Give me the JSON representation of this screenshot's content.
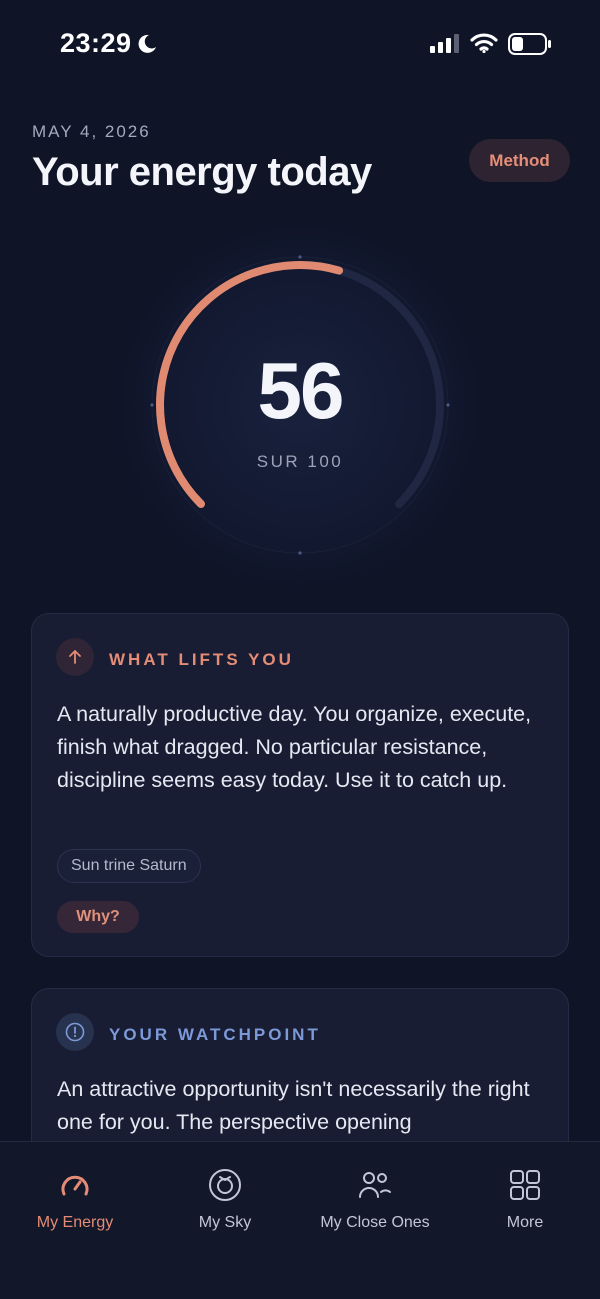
{
  "status_bar": {
    "time": "23:29",
    "icons": [
      "moon-icon",
      "signal-icon",
      "wifi-icon",
      "battery-icon"
    ]
  },
  "header": {
    "date": "MAY 4, 2026",
    "title": "Your energy today",
    "method_label": "Method"
  },
  "gauge": {
    "score": "56",
    "scale_label": "SUR 100",
    "score_value": 56,
    "score_max": 100,
    "arc_color": "#e08a72",
    "track_color": "#1f2742"
  },
  "cards": {
    "lifts": {
      "icon": "arrow-up-icon",
      "heading": "WHAT LIFTS YOU",
      "text": "A naturally productive day. You organize, execute, finish what dragged. No particular resistance, discipline seems easy today. Use it to catch up.",
      "aspect": "Sun trine Saturn",
      "why_label": "Why?",
      "accent": "#e58c76"
    },
    "watchpoint": {
      "icon": "alert-circle-icon",
      "heading": "YOUR WATCHPOINT",
      "text": "An attractive opportunity isn't necessarily the right one for you. The perspective opening",
      "accent": "#7c99d8"
    }
  },
  "tabs": [
    {
      "label": "My Energy",
      "icon": "gauge-icon",
      "active": true
    },
    {
      "label": "My Sky",
      "icon": "sky-icon",
      "active": false
    },
    {
      "label": "My Close Ones",
      "icon": "people-icon",
      "active": false
    },
    {
      "label": "More",
      "icon": "grid-icon",
      "active": false
    }
  ],
  "colors": {
    "background": "#0f1427",
    "accent": "#e58c76",
    "accent_blue": "#7c99d8"
  }
}
